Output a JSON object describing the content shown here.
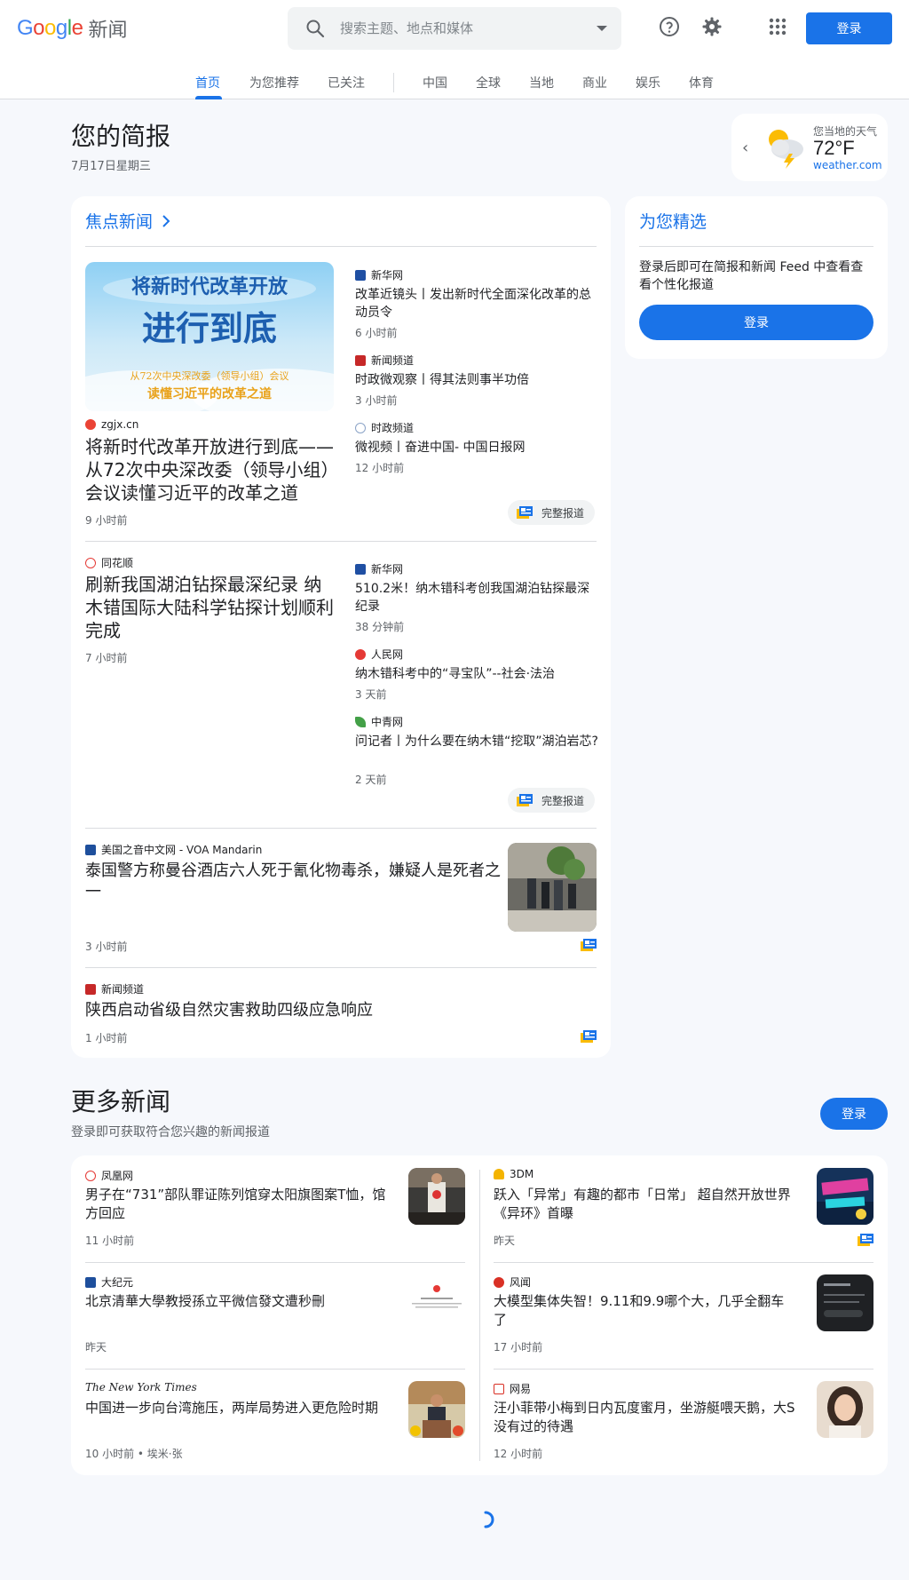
{
  "header": {
    "logo_letters": [
      "G",
      "o",
      "o",
      "g",
      "l",
      "e"
    ],
    "logo_suffix": "新闻",
    "search_placeholder": "搜索主题、地点和媒体",
    "login_label": "登录",
    "tabs": [
      {
        "label": "首页",
        "active": true
      },
      {
        "label": "为您推荐"
      },
      {
        "label": "已关注"
      },
      {
        "label": "中国"
      },
      {
        "label": "全球"
      },
      {
        "label": "当地"
      },
      {
        "label": "商业"
      },
      {
        "label": "娱乐"
      },
      {
        "label": "体育"
      }
    ]
  },
  "briefing": {
    "title": "您的简报",
    "date": "7月17日星期三"
  },
  "weather": {
    "location": "您当地的天气",
    "temperature": "72°F",
    "source": "weather.com"
  },
  "top_stories": {
    "title": "焦点新闻",
    "full_coverage_label": "完整报道",
    "cluster1": {
      "main": {
        "source": "zgjx.cn",
        "headline": "将新时代改革开放进行到底——从72次中央深改委（领导小组）会议读懂习近平的改革之道",
        "time": "9 小时前",
        "image_lines": [
          "将新时代改革开放",
          "进行到底",
          "从72次中央深改委（领导小组）会议",
          "读懂习近平的改革之道"
        ]
      },
      "side": [
        {
          "source": "新华网",
          "headline": "改革近镜头丨发出新时代全面深化改革的总动员令",
          "time": "6 小时前"
        },
        {
          "source": "新闻频道",
          "headline": "时政微观察丨得其法则事半功倍",
          "time": "3 小时前"
        },
        {
          "source": "时政频道",
          "headline": "微视频丨奋进中国- 中国日报网",
          "time": "12 小时前"
        }
      ]
    },
    "cluster2": {
      "main": {
        "source": "同花顺",
        "headline": "刷新我国湖泊钻探最深纪录 纳木错国际大陆科学钻探计划顺利完成",
        "time": "7 小时前"
      },
      "side": [
        {
          "source": "新华网",
          "headline": "510.2米！纳木错科考创我国湖泊钻探最深纪录",
          "time": "38 分钟前"
        },
        {
          "source": "人民网",
          "headline": "纳木错科考中的“寻宝队”--社会·法治",
          "time": "3 天前"
        },
        {
          "source": "中青网",
          "headline": "问记者丨为什么要在纳木错“挖取”湖泊岩芯?",
          "time": "2 天前"
        }
      ]
    },
    "story3": {
      "source": "美国之音中文网 - VOA Mandarin",
      "headline": "泰国警方称曼谷酒店六人死于氰化物毒杀，嫌疑人是死者之一",
      "time": "3 小时前"
    },
    "story4": {
      "source": "新闻频道",
      "headline": "陕西启动省级自然灾害救助四级应急响应",
      "time": "1 小时前"
    }
  },
  "for_you": {
    "title": "为您精选",
    "text": "登录后即可在简报和新闻 Feed 中查看查看个性化报道",
    "button": "登录"
  },
  "more_news": {
    "title": "更多新闻",
    "subtitle": "登录即可获取符合您兴趣的新闻报道",
    "button": "登录",
    "items": [
      {
        "source": "凤凰网",
        "headline": "男子在“731”部队罪证陈列馆穿太阳旗图案T恤，馆方回应",
        "time": "11 小时前"
      },
      {
        "source": "3DM",
        "headline": "跃入「异常」有趣的都市「日常」 超自然开放世界《异环》首曝",
        "time": "昨天"
      },
      {
        "source": "大纪元",
        "headline": "北京清華大學教授孫立平微信發文遭秒刪",
        "time": "昨天"
      },
      {
        "source": "风闻",
        "headline": "大模型集体失智！9.11和9.9哪个大，几乎全翻车了",
        "time": "17 小时前"
      },
      {
        "source": "The New York Times",
        "headline": "中国进一步向台湾施压，两岸局势进入更危险时期",
        "time": "10 小时前 • 埃米·张"
      },
      {
        "source": "网易",
        "headline": "汪小菲带小梅到日内瓦度蜜月，坐游艇喂天鹅，大S没有过的待遇",
        "time": "12 小时前"
      }
    ]
  },
  "colors": {
    "accent": "#1a73e8",
    "background": "#f6f8fc",
    "card": "#ffffff"
  }
}
